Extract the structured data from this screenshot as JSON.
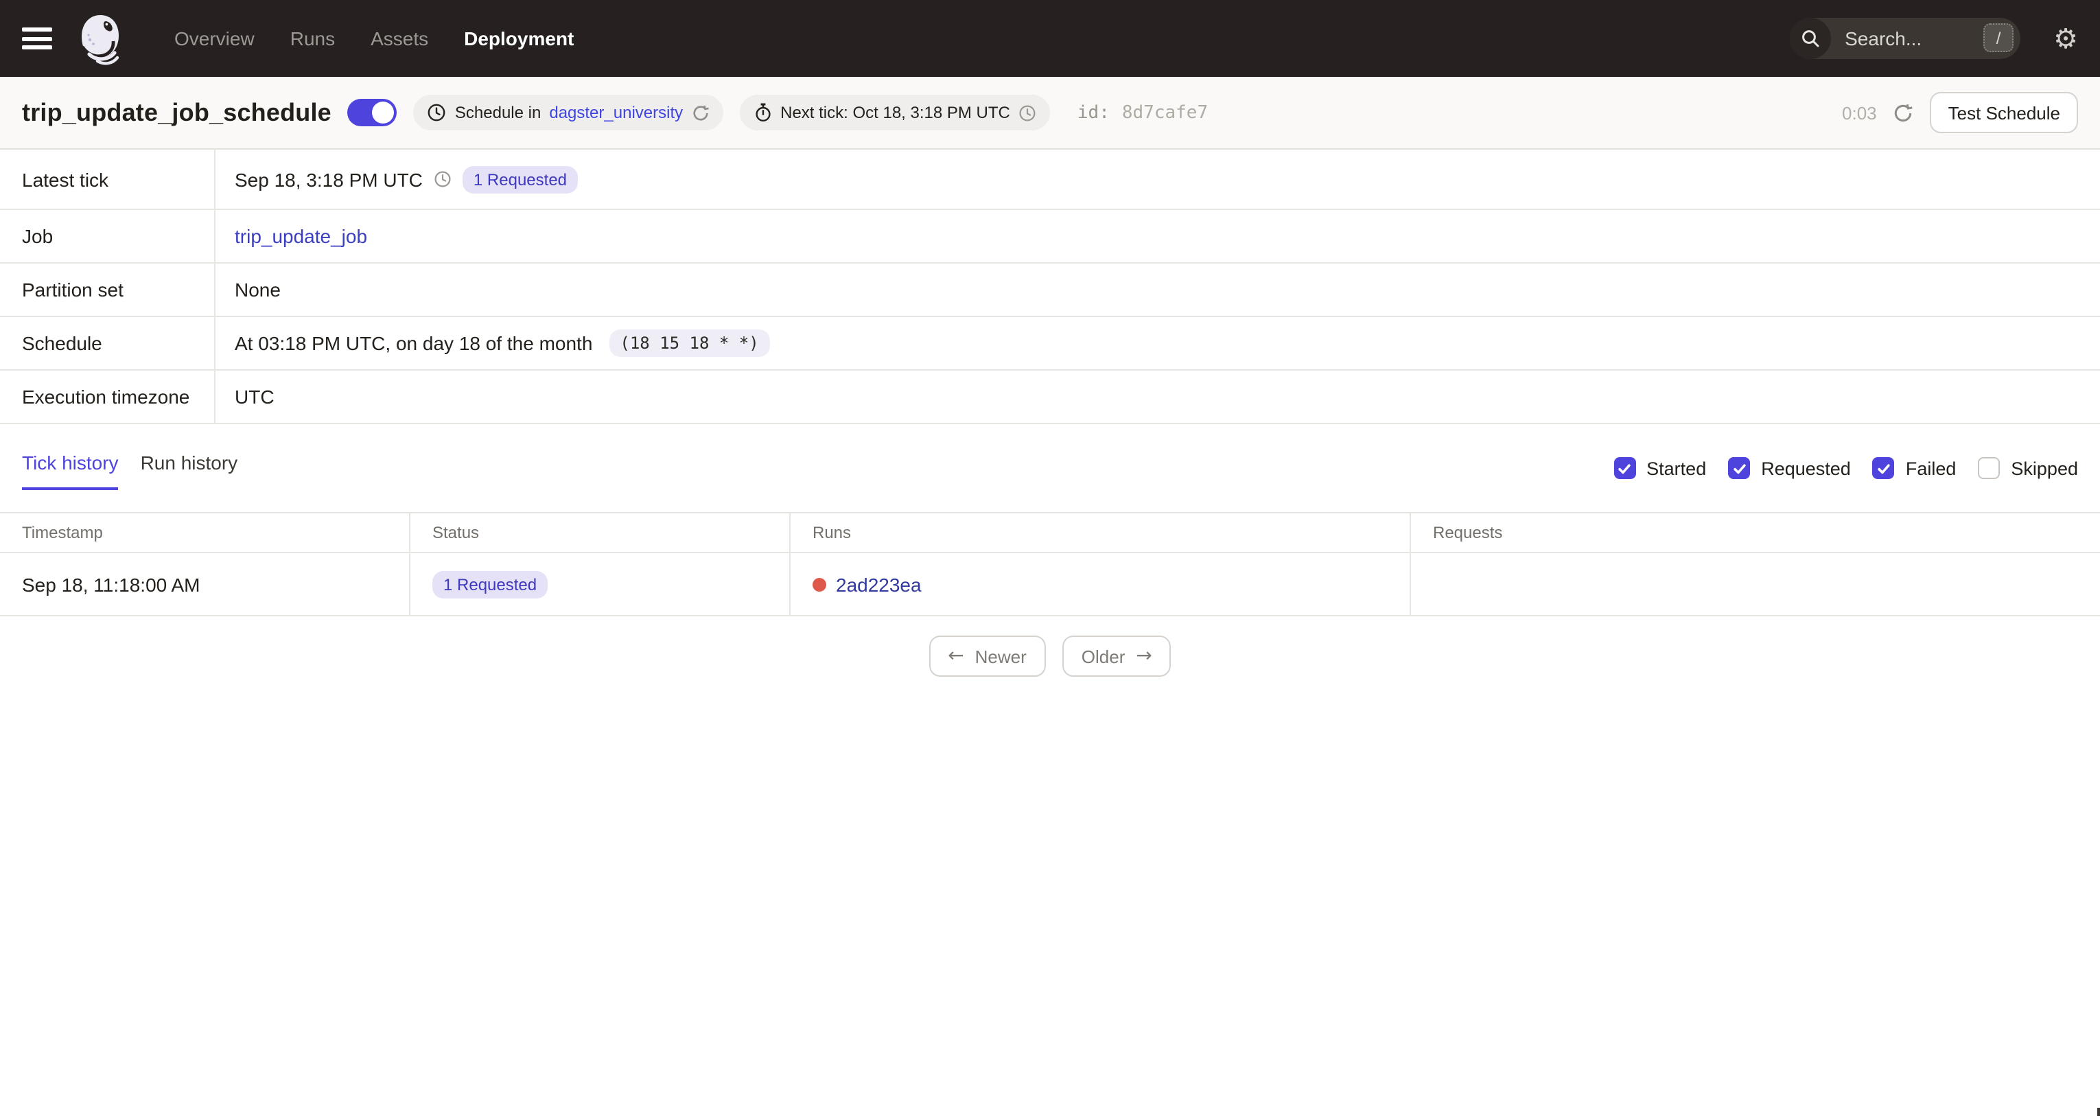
{
  "colors": {
    "accent": "#4F43DD",
    "nav_bg": "#262120",
    "badge_bg": "#E5E2F7",
    "badge_text": "#3E39BE",
    "link_bright": "#3E45E3",
    "link_job": "#3B3EC2",
    "link_run": "#333A9F",
    "status_dot_red": "#DE584C"
  },
  "nav": {
    "items": [
      {
        "label": "Overview",
        "active": false
      },
      {
        "label": "Runs",
        "active": false
      },
      {
        "label": "Assets",
        "active": false
      },
      {
        "label": "Deployment",
        "active": true
      }
    ],
    "search": {
      "placeholder": "Search...",
      "shortcut_key": "/"
    }
  },
  "header": {
    "title": "trip_update_job_schedule",
    "toggle_on": true,
    "repo_tag": {
      "text": "Schedule in",
      "link": "dagster_university"
    },
    "next_tick_tag": {
      "text": "Next tick: Oct 18, 3:18 PM UTC"
    },
    "id_label": "id:",
    "id_value": "8d7cafe7",
    "countdown": "0:03",
    "test_schedule_button": "Test Schedule"
  },
  "details": {
    "latest_tick": {
      "label": "Latest tick",
      "time": "Sep 18, 3:18 PM UTC",
      "badge": "1 Requested"
    },
    "job": {
      "label": "Job",
      "link": "trip_update_job"
    },
    "partition_set": {
      "label": "Partition set",
      "value": "None"
    },
    "schedule": {
      "label": "Schedule",
      "value": "At 03:18 PM UTC, on day 18 of the month",
      "cron": "(18 15 18 * *)"
    },
    "execution_timezone": {
      "label": "Execution timezone",
      "value": "UTC"
    }
  },
  "tabs": [
    {
      "label": "Tick history",
      "active": true
    },
    {
      "label": "Run history",
      "active": false
    }
  ],
  "filters": [
    {
      "label": "Started",
      "checked": true
    },
    {
      "label": "Requested",
      "checked": true
    },
    {
      "label": "Failed",
      "checked": true
    },
    {
      "label": "Skipped",
      "checked": false
    }
  ],
  "tick_table": {
    "headers": [
      "Timestamp",
      "Status",
      "Runs",
      "Requests"
    ],
    "rows": [
      {
        "timestamp": "Sep 18, 11:18:00 AM",
        "status_badge": "1 Requested",
        "run_id": "2ad223ea",
        "requests": ""
      }
    ]
  },
  "pagination": {
    "newer_arrow": "←",
    "newer": "Newer",
    "older": "Older",
    "older_arrow": "→"
  }
}
